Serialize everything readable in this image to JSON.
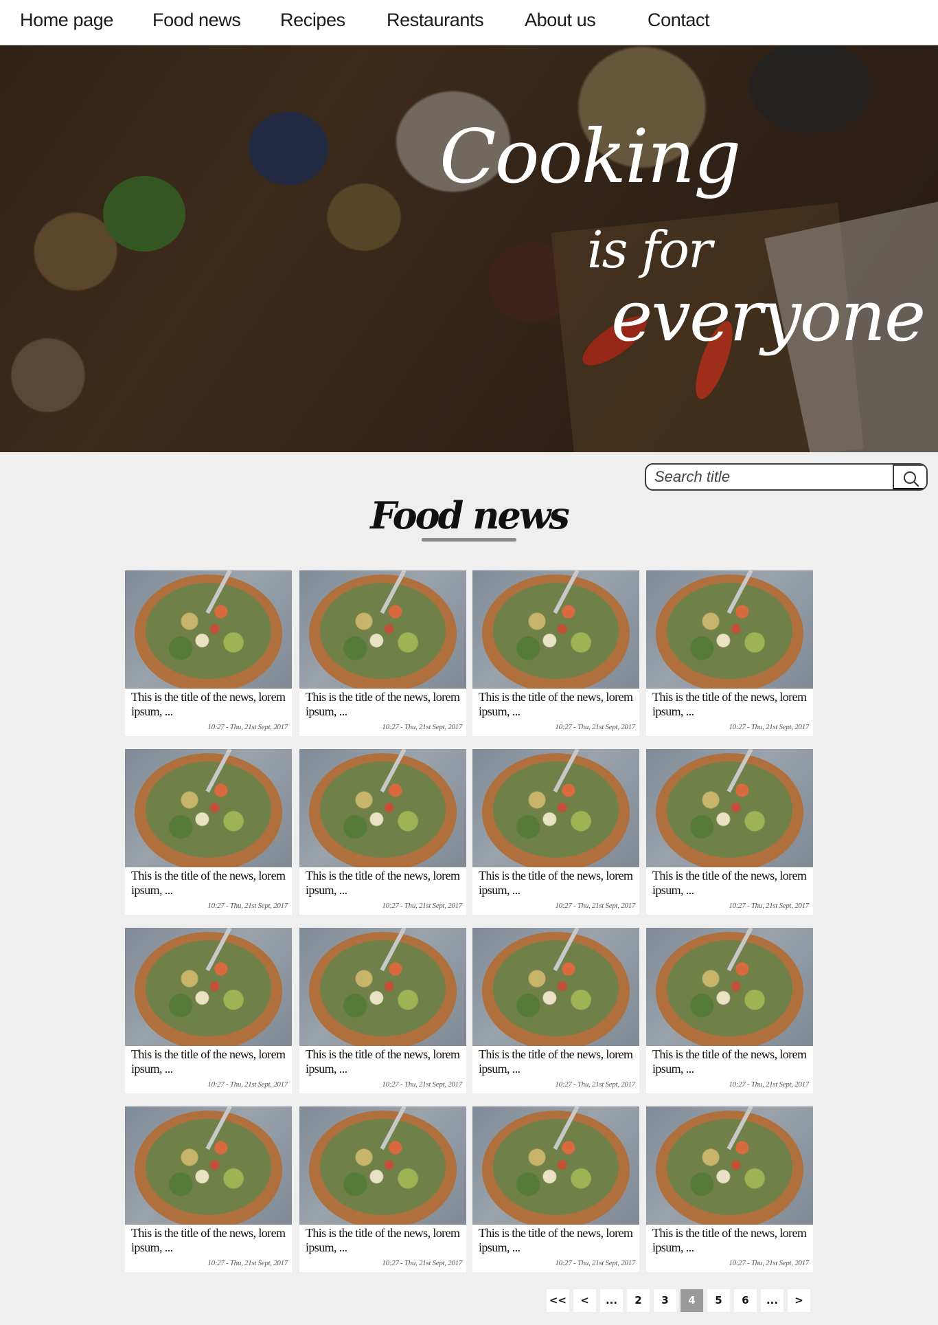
{
  "nav": {
    "items": [
      "Home page",
      "Food news",
      "Recipes",
      "Restaurants",
      "About us",
      "Contact"
    ]
  },
  "hero": {
    "line1": "Cooking",
    "line2": "is for",
    "line3": "everyone"
  },
  "search": {
    "placeholder": "Search title",
    "button_icon": "search-icon"
  },
  "section": {
    "title": "Food news"
  },
  "news": {
    "items": [
      {
        "title": "This is the title of the news, lorem ipsum, ...",
        "time": "10:27 - Thu, 21st Sept, 2017"
      },
      {
        "title": "This is the title of the news, lorem ipsum, ...",
        "time": "10:27 - Thu, 21st Sept, 2017"
      },
      {
        "title": "This is the title of the news, lorem ipsum, ...",
        "time": "10:27 - Thu, 21st Sept, 2017"
      },
      {
        "title": "This is the title of the news, lorem ipsum, ...",
        "time": "10:27 - Thu, 21st Sept, 2017"
      },
      {
        "title": "This is the title of the news, lorem ipsum, ...",
        "time": "10:27 - Thu, 21st Sept, 2017"
      },
      {
        "title": "This is the title of the news, lorem ipsum, ...",
        "time": "10:27 - Thu, 21st Sept, 2017"
      },
      {
        "title": "This is the title of the news, lorem ipsum, ...",
        "time": "10:27 - Thu, 21st Sept, 2017"
      },
      {
        "title": "This is the title of the news, lorem ipsum, ...",
        "time": "10:27 - Thu, 21st Sept, 2017"
      },
      {
        "title": "This is the title of the news, lorem ipsum, ...",
        "time": "10:27 - Thu, 21st Sept, 2017"
      },
      {
        "title": "This is the title of the news, lorem ipsum, ...",
        "time": "10:27 - Thu, 21st Sept, 2017"
      },
      {
        "title": "This is the title of the news, lorem ipsum, ...",
        "time": "10:27 - Thu, 21st Sept, 2017"
      },
      {
        "title": "This is the title of the news, lorem ipsum, ...",
        "time": "10:27 - Thu, 21st Sept, 2017"
      },
      {
        "title": "This is the title of the news, lorem ipsum, ...",
        "time": "10:27 - Thu, 21st Sept, 2017"
      },
      {
        "title": "This is the title of the news, lorem ipsum, ...",
        "time": "10:27 - Thu, 21st Sept, 2017"
      },
      {
        "title": "This is the title of the news, lorem ipsum, ...",
        "time": "10:27 - Thu, 21st Sept, 2017"
      },
      {
        "title": "This is the title of the news, lorem ipsum, ...",
        "time": "10:27 - Thu, 21st Sept, 2017"
      }
    ]
  },
  "pagination": {
    "buttons": [
      "<<",
      "<",
      "...",
      "2",
      "3",
      "4",
      "5",
      "6",
      "...",
      ">"
    ],
    "current": "4"
  }
}
